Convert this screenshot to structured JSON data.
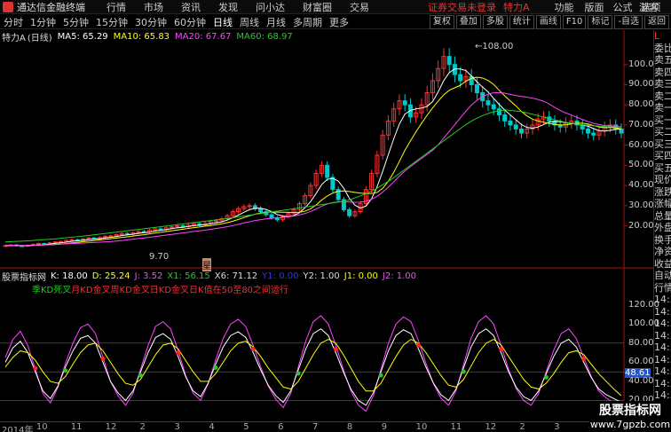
{
  "titlebar": {
    "app_title": "通达信金融终端",
    "menus": [
      "行情",
      "市场",
      "资讯",
      "发现",
      "问小达",
      "财富圈",
      "交易"
    ],
    "login_warning": "证券交易未登录",
    "stock_name": "特力A",
    "right_menus": [
      "功能",
      "版面",
      "公式",
      "选项"
    ],
    "guest": "游客"
  },
  "toolbar": {
    "periods": [
      "分时",
      "1分钟",
      "5分钟",
      "15分钟",
      "30分钟",
      "60分钟",
      "日线",
      "周线",
      "月线",
      "多周期",
      "更多"
    ],
    "active": "日线",
    "right_buttons": [
      "复权",
      "叠加",
      "多股",
      "统计",
      "画线",
      "F10",
      "标记",
      "-自选",
      "返回"
    ]
  },
  "maline": {
    "stock": "特力A",
    "period": "(日线)",
    "ma5": "MA5: 65.29",
    "ma10": "MA10: 65.83",
    "ma20": "MA20: 67.67",
    "ma60": "MA60: 68.97"
  },
  "price_axis": {
    "ticks": [
      "100.0",
      "90.00",
      "80.00",
      "70.00",
      "60.00",
      "50.00",
      "40.00",
      "30.00",
      "20.00"
    ],
    "high_label": "108.00",
    "low_label": "9.70",
    "mark": "星"
  },
  "indicator": {
    "name": "股票指标网",
    "values": [
      "K: 18.00",
      "D: 25.24",
      "J: 3.52",
      "X1: 56.15",
      "X6: 71.12",
      "Y1: 0.00",
      "Y2: 1.00",
      "J1: 0.00",
      "J2: 1.00"
    ],
    "legend_green": "季KD死叉",
    "legend_red": "月KD金叉周KD金叉日KD金叉日K值在50至80之间运行",
    "ticks": [
      "120.00",
      "100.00",
      "80.00",
      "60.00",
      "40.00",
      "20.00"
    ],
    "current": "48.61"
  },
  "right_panel": [
    "L",
    "委比",
    "卖五",
    "卖四",
    "卖三",
    "卖二",
    "卖一",
    "买一",
    "买二",
    "买三",
    "买四",
    "买五",
    "现价",
    "涨跌",
    "涨幅",
    "总量",
    "外盘",
    "换手",
    "净资",
    "收益",
    "自动",
    "行情",
    "14:5",
    "14:5",
    "14:5",
    "14:5",
    "14:5",
    "14:5",
    "14:5",
    "14:5",
    "14:5",
    "14:5"
  ],
  "date_axis": [
    "2014年",
    "10",
    "11",
    "12",
    "2",
    "3",
    "4",
    "5",
    "6",
    "7",
    "8",
    "9",
    "10",
    "11",
    "12",
    "2",
    "3",
    "4"
  ],
  "watermark": {
    "title": "股票指标网",
    "url": "www.7gpzb.com"
  },
  "colors": {
    "up": "#ff3030",
    "down": "#00c8c8",
    "ma5": "#ffffff",
    "ma10": "#ffff00",
    "ma20": "#ff44ff",
    "ma60": "#22cc22"
  },
  "chart_data": {
    "type": "line",
    "price": {
      "close": [
        10.2,
        10.5,
        10.1,
        9.9,
        10.3,
        10.8,
        11.2,
        11.0,
        11.5,
        12.0,
        12.2,
        12.8,
        13.1,
        12.7,
        13.5,
        14.0,
        13.6,
        14.2,
        14.8,
        15.0,
        15.6,
        16.2,
        15.8,
        16.5,
        17.2,
        17.0,
        17.8,
        18.5,
        18.2,
        19.0,
        19.5,
        20.0,
        19.6,
        20.3,
        21.0,
        20.5,
        21.2,
        22.0,
        22.5,
        23.5,
        25.0,
        27.0,
        28.5,
        29.5,
        30.0,
        28.5,
        27.0,
        25.5,
        24.0,
        23.0,
        24.5,
        26.0,
        28.0,
        31.0,
        35.0,
        40.0,
        46.0,
        50.0,
        44.0,
        38.0,
        33.0,
        28.0,
        25.0,
        27.0,
        31.0,
        38.0,
        46.0,
        55.0,
        65.0,
        72.0,
        78.0,
        82.0,
        80.0,
        74.0,
        76.0,
        80.0,
        86.0,
        92.0,
        98.0,
        104.0,
        100.0,
        95.0,
        92.0,
        94.0,
        90.0,
        86.0,
        82.0,
        80.0,
        78.0,
        75.0,
        72.0,
        70.0,
        68.0,
        66.0,
        68.0,
        70.0,
        73.0,
        74.0,
        72.0,
        70.0,
        69.0,
        71.0,
        72.0,
        70.0,
        68.0,
        66.0,
        65.0,
        67.0,
        69.0,
        70.0,
        68.0,
        66.0
      ],
      "ma60": [
        12,
        12.2,
        12.4,
        12.6,
        12.9,
        13.2,
        13.5,
        13.9,
        14.3,
        14.7,
        15.1,
        15.6,
        16.1,
        16.6,
        17.1,
        17.6,
        18.1,
        18.6,
        19.1,
        19.6,
        20.1,
        20.6,
        21.1,
        21.6,
        22.1,
        22.6,
        23.1,
        23.6,
        24.2,
        24.8,
        25.4,
        26.0,
        26.6,
        27.2,
        27.8,
        28.4,
        29.0,
        29.6,
        30.2,
        30.8,
        31.4,
        32.0,
        33.0,
        34.5,
        36.0,
        38.0,
        40.5,
        43.0,
        46.0,
        49.0,
        52.0,
        55.0,
        58.0,
        61.0,
        64.0,
        67.0,
        70.0,
        72.5,
        74.5,
        76.0,
        77.0,
        77.5,
        77.0,
        76.5,
        75.5,
        74.5,
        73.5,
        72.5,
        71.5,
        70.8,
        70.2,
        69.8,
        69.5,
        69.2,
        69.0,
        68.97
      ]
    },
    "indicator": {
      "k": [
        60,
        75,
        82,
        70,
        50,
        30,
        22,
        35,
        55,
        72,
        85,
        88,
        80,
        60,
        40,
        28,
        20,
        30,
        50,
        70,
        86,
        90,
        84,
        66,
        45,
        30,
        24,
        38,
        58,
        76,
        88,
        92,
        86,
        70,
        52,
        36,
        25,
        18,
        30,
        52,
        74,
        90,
        95,
        88,
        70,
        50,
        32,
        20,
        15,
        28,
        50,
        72,
        88,
        94,
        90,
        74,
        55,
        38,
        26,
        20,
        32,
        54,
        76,
        90,
        95,
        88,
        70,
        50,
        34,
        24,
        20,
        30,
        48,
        66,
        80,
        84,
        76,
        60,
        44,
        32,
        26,
        22,
        18
      ],
      "d": [
        55,
        65,
        72,
        70,
        62,
        50,
        40,
        38,
        45,
        58,
        70,
        78,
        80,
        72,
        60,
        48,
        38,
        36,
        42,
        55,
        68,
        78,
        80,
        74,
        62,
        50,
        40,
        40,
        48,
        60,
        72,
        80,
        82,
        76,
        66,
        54,
        44,
        34,
        32,
        40,
        54,
        68,
        80,
        84,
        80,
        68,
        54,
        40,
        30,
        30,
        38,
        52,
        66,
        78,
        84,
        80,
        70,
        58,
        46,
        36,
        34,
        42,
        56,
        70,
        80,
        84,
        78,
        66,
        54,
        42,
        34,
        32,
        38,
        48,
        60,
        70,
        72,
        68,
        58,
        48,
        40,
        32,
        25
      ]
    }
  }
}
